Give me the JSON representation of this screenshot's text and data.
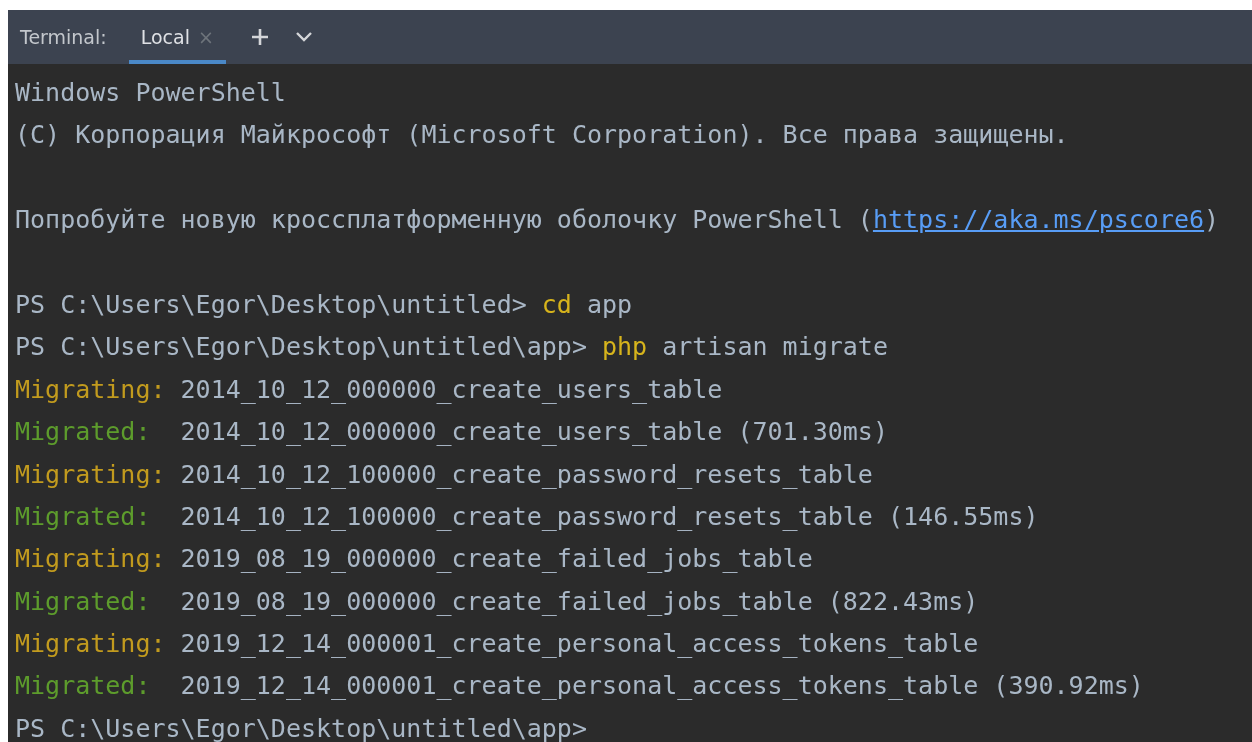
{
  "toolbar": {
    "title": "Terminal:",
    "tabs": [
      {
        "label": "Local",
        "selected": true,
        "close": "×"
      }
    ]
  },
  "lines": [
    {
      "kind": "text",
      "segments": [
        {
          "kind": "plain",
          "text": "Windows PowerShell"
        }
      ]
    },
    {
      "kind": "text",
      "segments": [
        {
          "kind": "plain",
          "text": "(C) Корпорация Майкрософт (Microsoft Corporation). Все права защищены."
        }
      ]
    },
    {
      "kind": "blank"
    },
    {
      "kind": "text",
      "segments": [
        {
          "kind": "plain",
          "text": "Попробуйте новую кроссплатформенную оболочку PowerShell ("
        },
        {
          "kind": "link",
          "text": "https://aka.ms/pscore6"
        },
        {
          "kind": "plain",
          "text": ")"
        }
      ]
    },
    {
      "kind": "blank"
    },
    {
      "kind": "text",
      "segments": [
        {
          "kind": "prompt",
          "text": "PS C:\\Users\\Egor\\Desktop\\untitled>"
        },
        {
          "kind": "command",
          "text": "cd"
        },
        {
          "kind": "plain",
          "text": "app"
        }
      ]
    },
    {
      "kind": "text",
      "segments": [
        {
          "kind": "prompt",
          "text": "PS C:\\Users\\Egor\\Desktop\\untitled\\app>"
        },
        {
          "kind": "command",
          "text": "php"
        },
        {
          "kind": "plain",
          "text": "artisan migrate"
        }
      ]
    },
    {
      "kind": "text",
      "segments": [
        {
          "kind": "migrating",
          "text": "Migrating:"
        },
        {
          "kind": "plain",
          "text": "2014_10_12_000000_create_users_table"
        }
      ]
    },
    {
      "kind": "text",
      "segments": [
        {
          "kind": "migrated",
          "text": "Migrated:"
        },
        {
          "kind": "plain",
          "text": "2014_10_12_000000_create_users_table (701.30ms)"
        }
      ]
    },
    {
      "kind": "text",
      "segments": [
        {
          "kind": "migrating",
          "text": "Migrating:"
        },
        {
          "kind": "plain",
          "text": "2014_10_12_100000_create_password_resets_table"
        }
      ]
    },
    {
      "kind": "text",
      "segments": [
        {
          "kind": "migrated",
          "text": "Migrated:"
        },
        {
          "kind": "plain",
          "text": "2014_10_12_100000_create_password_resets_table (146.55ms)"
        }
      ]
    },
    {
      "kind": "text",
      "segments": [
        {
          "kind": "migrating",
          "text": "Migrating:"
        },
        {
          "kind": "plain",
          "text": "2019_08_19_000000_create_failed_jobs_table"
        }
      ]
    },
    {
      "kind": "text",
      "segments": [
        {
          "kind": "migrated",
          "text": "Migrated:"
        },
        {
          "kind": "plain",
          "text": "2019_08_19_000000_create_failed_jobs_table (822.43ms)"
        }
      ]
    },
    {
      "kind": "text",
      "segments": [
        {
          "kind": "migrating",
          "text": "Migrating:"
        },
        {
          "kind": "plain",
          "text": "2019_12_14_000001_create_personal_access_tokens_table"
        }
      ]
    },
    {
      "kind": "text",
      "segments": [
        {
          "kind": "migrated",
          "text": "Migrated:"
        },
        {
          "kind": "plain",
          "text": "2019_12_14_000001_create_personal_access_tokens_table (390.92ms)"
        }
      ]
    },
    {
      "kind": "text",
      "segments": [
        {
          "kind": "prompt",
          "text": "PS C:\\Users\\Egor\\Desktop\\untitled\\app>"
        }
      ]
    }
  ]
}
